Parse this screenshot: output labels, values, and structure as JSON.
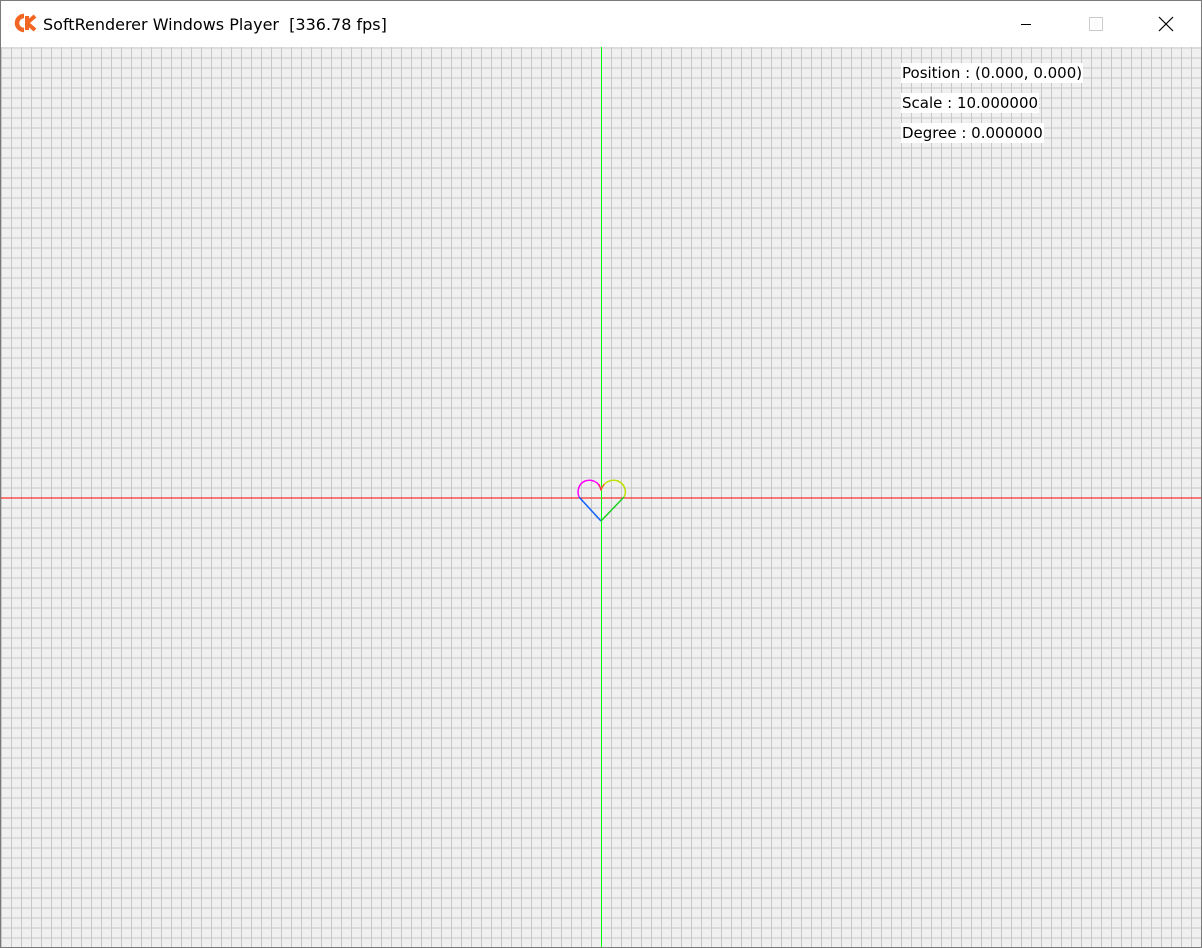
{
  "window": {
    "title": "SoftRenderer Windows Player  [336.78 fps]",
    "app_icon": "ck-logo-icon",
    "controls": {
      "minimize_icon": "minimize-icon",
      "maximize_icon": "maximize-icon",
      "close_icon": "close-icon"
    }
  },
  "overlay": {
    "position_text": "Position : (0.000, 0.000)",
    "scale_text": "Scale : 10.000000",
    "degree_text": "Degree : 0.000000"
  },
  "colors": {
    "background": "#f0f0f0",
    "grid": "#c8c8c8",
    "x_axis": "#ff0000",
    "y_axis": "#00ff00",
    "logo": "#f26522"
  },
  "scene": {
    "position": [
      0.0,
      0.0
    ],
    "scale": 10.0,
    "degree": 0.0,
    "object": "heart",
    "object_gradient": [
      "#ff00ff",
      "#ff0000",
      "#ffff00",
      "#00ff00",
      "#00ffff",
      "#0000ff",
      "#ff00ff"
    ]
  }
}
